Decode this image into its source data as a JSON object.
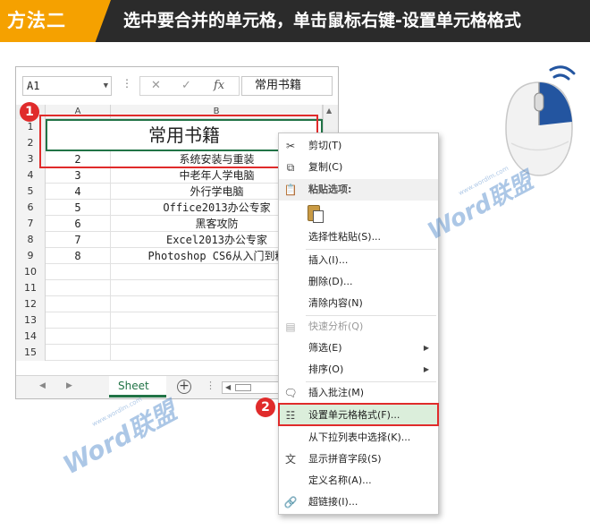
{
  "banner": {
    "tag": "方法二",
    "text": "选中要合并的单元格，单击鼠标右键-设置单元格格式"
  },
  "excel": {
    "name_box": "A1",
    "formula_buttons": [
      "✕",
      "✓",
      "fx"
    ],
    "formula_content": "常用书籍",
    "columns": [
      "A",
      "B"
    ],
    "merged_cell": "常用书籍",
    "rows": [
      {
        "n": "1",
        "a": "",
        "b": ""
      },
      {
        "n": "2",
        "a": "",
        "b": ""
      },
      {
        "n": "3",
        "a": "2",
        "b": "系统安装与重装"
      },
      {
        "n": "4",
        "a": "3",
        "b": "中老年人学电脑"
      },
      {
        "n": "5",
        "a": "4",
        "b": "外行学电脑"
      },
      {
        "n": "6",
        "a": "5",
        "b": "Office2013办公专家"
      },
      {
        "n": "7",
        "a": "6",
        "b": "黑客攻防"
      },
      {
        "n": "8",
        "a": "7",
        "b": "Excel2013办公专家"
      },
      {
        "n": "9",
        "a": "8",
        "b": "Photoshop CS6从入门到精"
      },
      {
        "n": "10",
        "a": "",
        "b": ""
      },
      {
        "n": "11",
        "a": "",
        "b": ""
      },
      {
        "n": "12",
        "a": "",
        "b": ""
      },
      {
        "n": "13",
        "a": "",
        "b": ""
      },
      {
        "n": "14",
        "a": "",
        "b": ""
      },
      {
        "n": "15",
        "a": "",
        "b": ""
      }
    ],
    "sheet_tab": "Sheet"
  },
  "badges": [
    "1",
    "2"
  ],
  "context_menu": {
    "items": [
      {
        "label": "剪切(T)",
        "icon": "scissors-icon"
      },
      {
        "label": "复制(C)",
        "icon": "copy-icon"
      },
      {
        "label": "粘贴选项:",
        "icon": "paste-icon"
      },
      {
        "label": "选择性粘贴(S)..."
      },
      {
        "label": "插入(I)..."
      },
      {
        "label": "删除(D)..."
      },
      {
        "label": "清除内容(N)"
      },
      {
        "label": "快速分析(Q)",
        "icon": "quick-analysis-icon"
      },
      {
        "label": "筛选(E)"
      },
      {
        "label": "排序(O)"
      },
      {
        "label": "插入批注(M)",
        "icon": "comment-icon"
      },
      {
        "label": "设置单元格格式(F)...",
        "icon": "format-cells-icon"
      },
      {
        "label": "从下拉列表中选择(K)..."
      },
      {
        "label": "显示拼音字段(S)",
        "icon": "pinyin-icon"
      },
      {
        "label": "定义名称(A)..."
      },
      {
        "label": "超链接(I)...",
        "icon": "hyperlink-icon"
      }
    ]
  },
  "watermark": {
    "brand": "Word联盟",
    "url": "www.wordlm.com"
  },
  "colors": {
    "banner_bg": "#2b2b2b",
    "banner_tag": "#f5a100",
    "excel_green": "#217346",
    "highlight_red": "#e02b2b",
    "menu_highlight": "#dbeedb",
    "mouse_blue": "#2355a0"
  }
}
